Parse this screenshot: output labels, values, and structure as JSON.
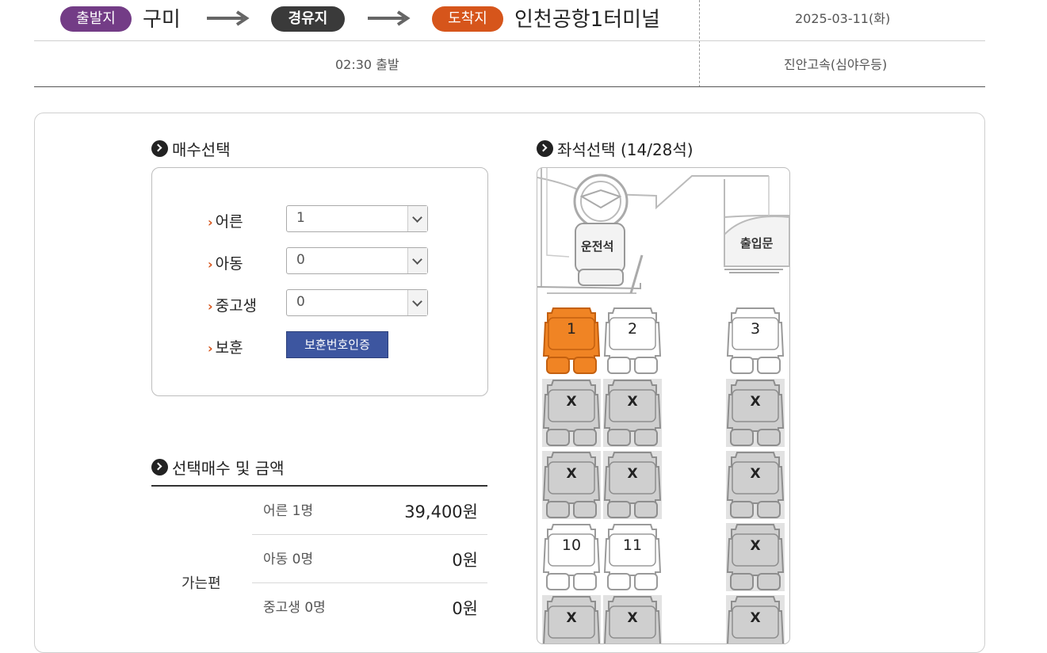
{
  "route": {
    "departure_tag": "출발지",
    "departure_city": "구미",
    "via_tag": "경유지",
    "arrival_tag": "도착지",
    "arrival_city": "인천공항1터미널",
    "date": "2025-03-11(화)",
    "departure_time": "02:30 출발",
    "company": "진안고속(심야우등)"
  },
  "count_section": {
    "title": "매수선택",
    "adult_label": "어른",
    "adult_value": "1",
    "child_label": "아동",
    "child_value": "0",
    "student_label": "중고생",
    "student_value": "0",
    "veteran_label": "보훈",
    "veteran_button": "보훈번호인증"
  },
  "summary": {
    "title": "선택매수 및 금액",
    "category": "가는편",
    "rows": [
      {
        "label": "어른 1명",
        "amount": "39,400원"
      },
      {
        "label": "아동 0명",
        "amount": "0원"
      },
      {
        "label": "중고생 0명",
        "amount": "0원"
      }
    ]
  },
  "seat_section": {
    "title": "좌석선택 (14/28석)",
    "driver_label": "운전석",
    "door_label": "출입문",
    "sold_mark": "X",
    "seats": [
      {
        "label": "1",
        "status": "selected"
      },
      {
        "label": "2",
        "status": "available"
      },
      {
        "label": "3",
        "status": "available"
      },
      {
        "label": "X",
        "status": "sold"
      },
      {
        "label": "X",
        "status": "sold"
      },
      {
        "label": "X",
        "status": "sold"
      },
      {
        "label": "X",
        "status": "sold"
      },
      {
        "label": "X",
        "status": "sold"
      },
      {
        "label": "X",
        "status": "sold"
      },
      {
        "label": "10",
        "status": "available"
      },
      {
        "label": "11",
        "status": "available"
      },
      {
        "label": "X",
        "status": "sold"
      },
      {
        "label": "X",
        "status": "sold"
      },
      {
        "label": "X",
        "status": "sold"
      },
      {
        "label": "X",
        "status": "sold"
      }
    ]
  },
  "colors": {
    "departure_pill": "#733c86",
    "via_pill": "#3a3a3a",
    "arrival_pill": "#d6551b",
    "selected_seat": "#f08424",
    "sold_seat": "#cfcfcf",
    "verify_button": "#3d56a0"
  }
}
